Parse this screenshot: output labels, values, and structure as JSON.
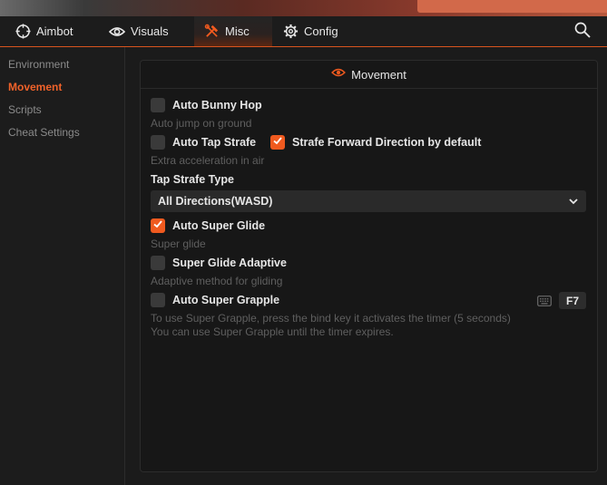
{
  "tabs": [
    {
      "label": "Aimbot",
      "icon": "crosshair-icon"
    },
    {
      "label": "Visuals",
      "icon": "eye-icon"
    },
    {
      "label": "Misc",
      "icon": "tools-icon",
      "active": true
    },
    {
      "label": "Config",
      "icon": "gear-icon"
    }
  ],
  "sidebar": {
    "items": [
      {
        "label": "Environment"
      },
      {
        "label": "Movement",
        "active": true
      },
      {
        "label": "Scripts"
      },
      {
        "label": "Cheat Settings"
      }
    ]
  },
  "panel": {
    "title": "Movement",
    "auto_bunny_hop": {
      "label": "Auto Bunny Hop",
      "checked": false,
      "desc": "Auto jump on ground"
    },
    "auto_tap_strafe": {
      "label": "Auto Tap Strafe",
      "checked": false,
      "desc": "Extra acceleration in air"
    },
    "strafe_forward": {
      "label": "Strafe Forward Direction by default",
      "checked": true
    },
    "tap_strafe_type": {
      "label": "Tap Strafe Type",
      "selected": "All Directions(WASD)"
    },
    "auto_super_glide": {
      "label": "Auto Super Glide",
      "checked": true,
      "desc": "Super glide"
    },
    "super_glide_adaptive": {
      "label": "Super Glide Adaptive",
      "checked": false,
      "desc": "Adaptive method for gliding"
    },
    "auto_super_grapple": {
      "label": "Auto Super Grapple",
      "checked": false,
      "keybind": "F7",
      "desc_line1": "To use Super Grapple, press the bind key it activates the timer (5 seconds)",
      "desc_line2": "You can use Super Grapple until the timer expires."
    }
  },
  "colors": {
    "accent": "#f05a1f",
    "background": "#1a1a1a",
    "panel": "#171717",
    "muted_text": "#5f5f5f"
  }
}
